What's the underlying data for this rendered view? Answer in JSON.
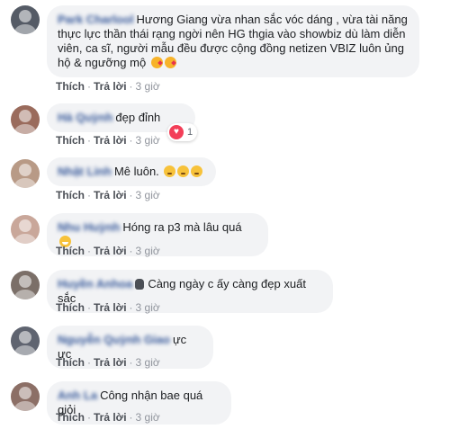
{
  "actions": {
    "like": "Thích",
    "reply": "Trả lời",
    "sep": "·"
  },
  "comments": [
    {
      "name": "Park Charlool",
      "text": "Hương Giang vừa nhan sắc vóc dáng , vừa tài năng thực lực thần thái rạng ngời nên HG thgia vào showbiz dù làm diễn viên, ca sĩ, người mẫu đều được cộng đồng netizen VBIZ luôn ủng hộ & ngưỡng mộ",
      "time": "3 giờ",
      "emojis": [
        "kiss-emoji",
        "kiss-emoji"
      ]
    },
    {
      "name": "Hà Quỳnh",
      "text": "đẹp đỉnh",
      "time": "3 giờ",
      "reaction": {
        "icon": "heart-icon",
        "count": "1"
      }
    },
    {
      "name": "Nhật Linh",
      "text": "Mê luôn.",
      "time": "3 giờ",
      "emojis": [
        "weary-emoji",
        "weary-emoji",
        "weary-emoji"
      ]
    },
    {
      "name": "Nhu Huỳnh",
      "text": "Hóng ra p3 mà lâu quá",
      "time": "3 giờ",
      "emojis": [
        "grin-emoji"
      ]
    },
    {
      "name": "Huyền Anhoa",
      "text": "Càng ngày c ấy càng đẹp xuất sắc",
      "time": "3 giờ",
      "icon": "hand-icon"
    },
    {
      "name": "Nguyễn Quỳnh Giao",
      "text": "ực ực",
      "time": "3 giờ"
    },
    {
      "name": "Anh La",
      "text": "Công nhận bae quá giỏi",
      "time": "3 giờ"
    }
  ]
}
